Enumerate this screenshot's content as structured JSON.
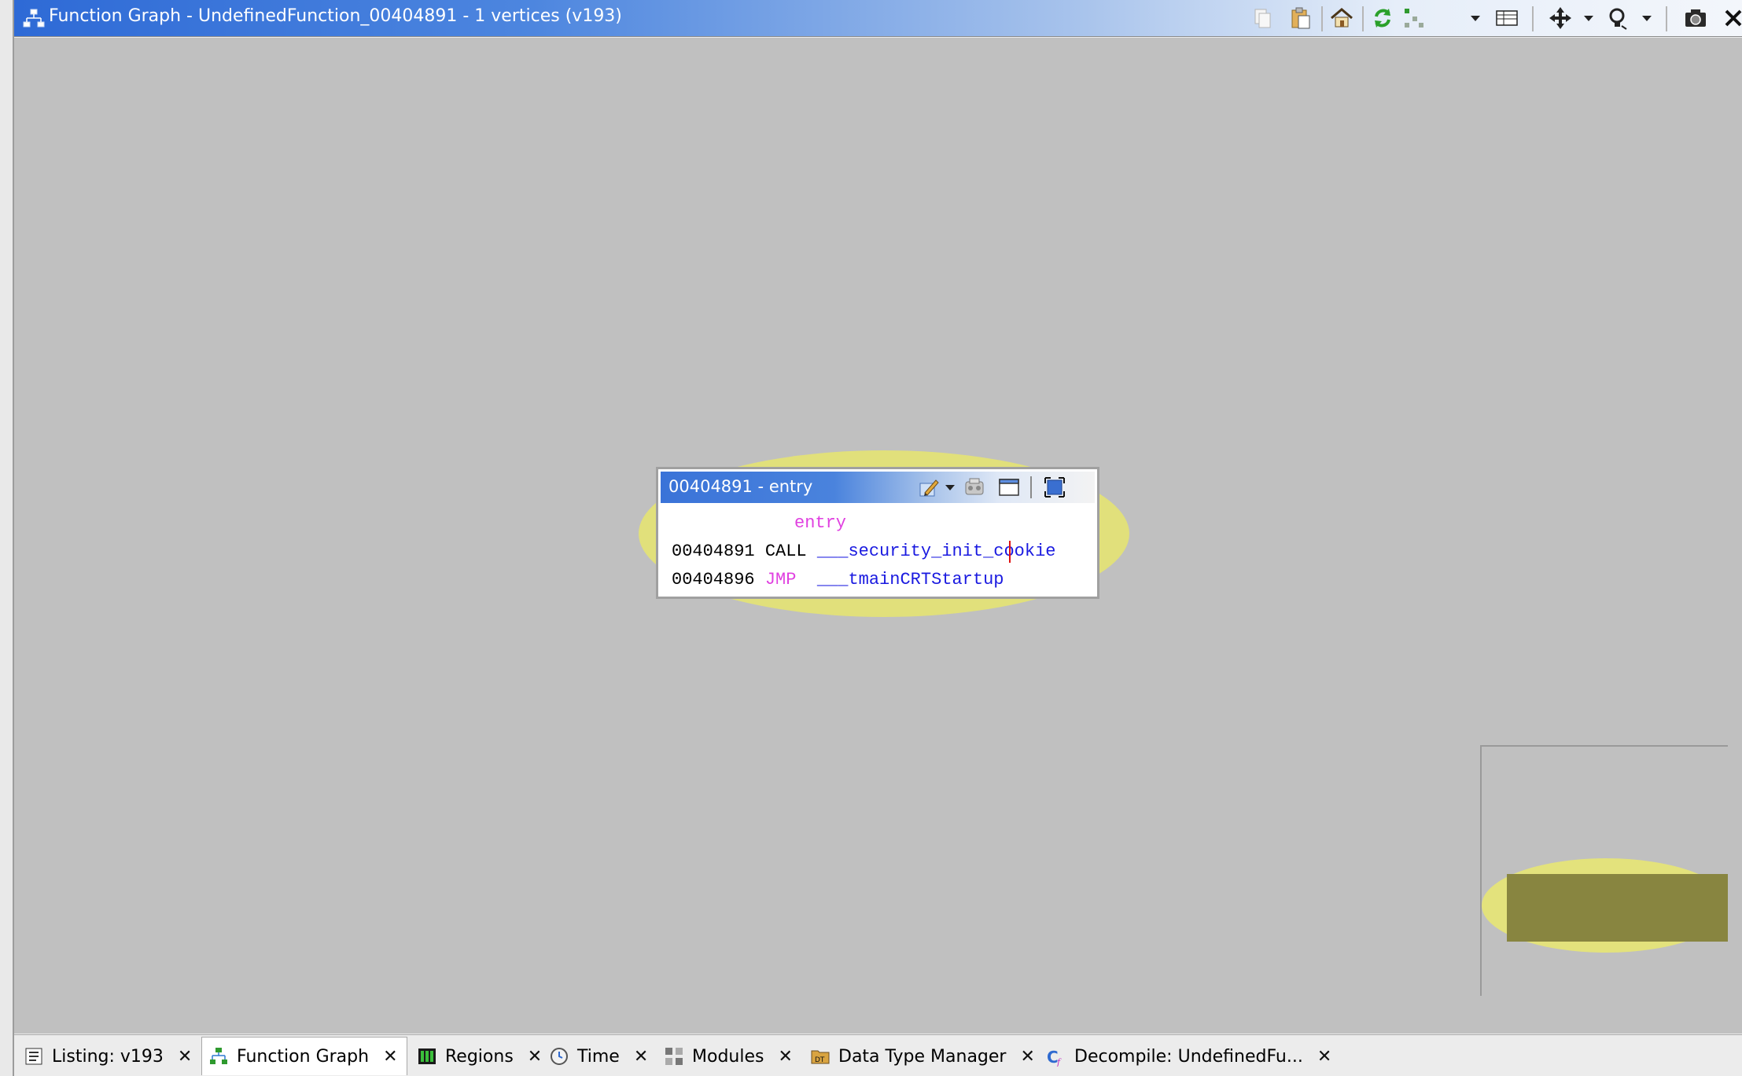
{
  "window": {
    "title": "Function Graph - UndefinedFunction_00404891 - 1 vertices  (v193)"
  },
  "toolbar": {
    "icons": [
      "copy-icon",
      "paste-icon",
      "home-icon",
      "refresh-icon",
      "layout-icon",
      "format-icon",
      "navigate-icon",
      "hover-icon",
      "snapshot-icon",
      "close-icon"
    ]
  },
  "vertex": {
    "title": "00404891 - entry",
    "label": "entry",
    "lines": [
      {
        "address": "00404891",
        "mnemonic": "CALL",
        "operand": "___security_init_cookie"
      },
      {
        "address": "00404896",
        "mnemonic": "JMP",
        "operand": "___tmainCRTStartup"
      }
    ]
  },
  "colors": {
    "canvas": "#c0c0c0",
    "highlight": "#e1e07b",
    "label": "#e040e0",
    "symbol": "#1a1ae0",
    "satellite_node": "#888540"
  },
  "tabs": [
    {
      "label": "Listing:  v193",
      "icon": "listing-icon"
    },
    {
      "label": "Function Graph",
      "icon": "function-graph-icon",
      "active": true
    },
    {
      "label": "Regions",
      "icon": "regions-icon"
    },
    {
      "label": "Time",
      "icon": "clock-icon"
    },
    {
      "label": "Modules",
      "icon": "modules-icon"
    },
    {
      "label": "Data Type Manager",
      "icon": "data-type-icon"
    },
    {
      "label": "Decompile: UndefinedFu...",
      "icon": "decompile-icon"
    }
  ]
}
